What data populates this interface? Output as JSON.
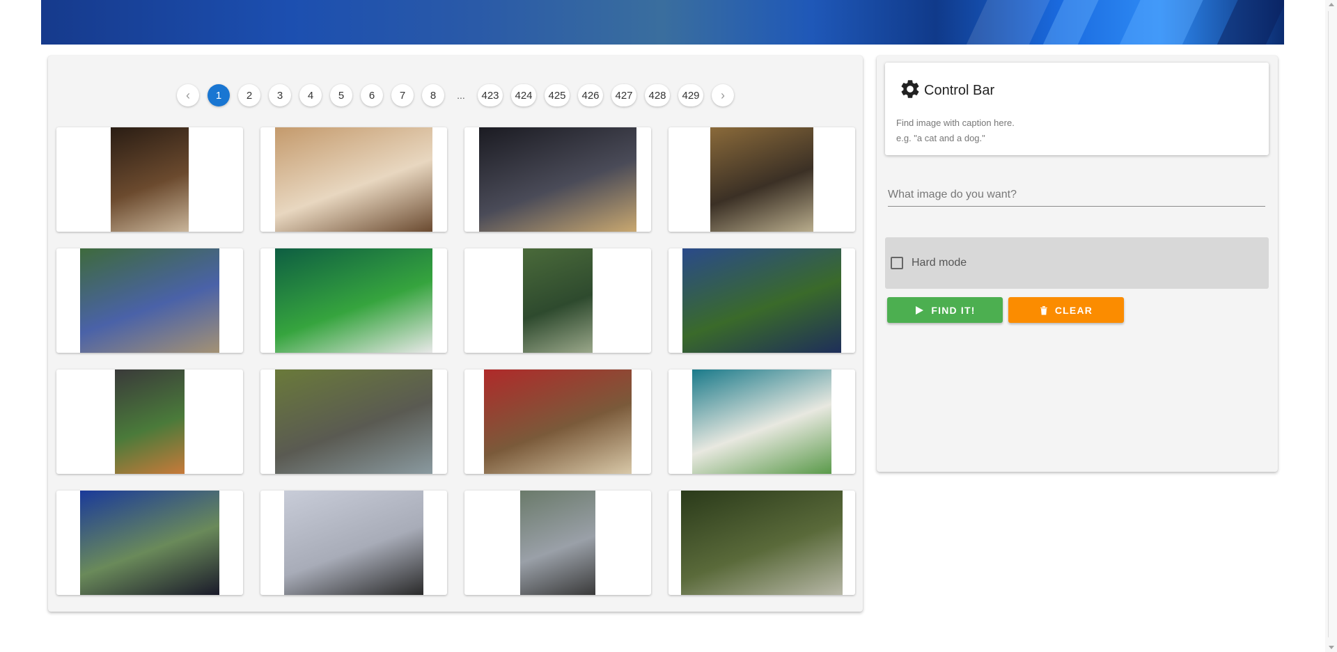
{
  "pager": {
    "prev": "‹",
    "next": "›",
    "pages_start": [
      "1",
      "2",
      "3",
      "4",
      "5",
      "6",
      "7",
      "8"
    ],
    "ellipsis": "...",
    "pages_end": [
      "423",
      "424",
      "425",
      "426",
      "427",
      "428",
      "429"
    ],
    "active": "1"
  },
  "control": {
    "title": "Control Bar",
    "hint_line1": "Find image with caption here.",
    "hint_line2": "e.g. \"a cat and a dog.\"",
    "search_placeholder": "What image do you want?",
    "search_value": "",
    "hard_mode_label": "Hard mode",
    "hard_mode_checked": false,
    "find_label": "FIND IT!",
    "clear_label": "CLEAR"
  },
  "images": [
    {
      "subject": "food platter on table",
      "palette": [
        "#2a1d14",
        "#6b4a2e",
        "#c9b59a"
      ]
    },
    {
      "subject": "living room with sofa",
      "palette": [
        "#c49a6c",
        "#e8d7c0",
        "#6a4a30"
      ]
    },
    {
      "subject": "two men shaking hands",
      "palette": [
        "#1b1b22",
        "#4a4b58",
        "#c9a870"
      ]
    },
    {
      "subject": "clock on wall",
      "palette": [
        "#8a6a3a",
        "#3b3025",
        "#b8ac8c"
      ]
    },
    {
      "subject": "tennis stadium",
      "palette": [
        "#3e6a3c",
        "#4a62a8",
        "#a49274"
      ]
    },
    {
      "subject": "tennis player in green",
      "palette": [
        "#0e5e42",
        "#36a43e",
        "#e8e8e8"
      ]
    },
    {
      "subject": "people at outdoor fair",
      "palette": [
        "#4a6a3a",
        "#2e4a2e",
        "#9aa78a"
      ]
    },
    {
      "subject": "cat on blue truck",
      "palette": [
        "#2a4a8a",
        "#3a6a2a",
        "#1e2e5a"
      ]
    },
    {
      "subject": "tennis player serving",
      "palette": [
        "#3a3a3a",
        "#4a7a3a",
        "#c87a3a"
      ]
    },
    {
      "subject": "elephants in grass",
      "palette": [
        "#6a7a3a",
        "#5a5a52",
        "#8a9aa0"
      ]
    },
    {
      "subject": "child with luggage",
      "palette": [
        "#b02a2a",
        "#7a5a3a",
        "#d8c8a8"
      ]
    },
    {
      "subject": "plates on blue table",
      "palette": [
        "#1a7a8a",
        "#e8e8e0",
        "#5a9a4a"
      ]
    },
    {
      "subject": "vases by window",
      "palette": [
        "#1a3a9a",
        "#6a8a5a",
        "#1a1a2a"
      ]
    },
    {
      "subject": "skiers on slope",
      "palette": [
        "#c8ccd8",
        "#a8acb8",
        "#2a2a2a"
      ]
    },
    {
      "subject": "skateboarder jumping",
      "palette": [
        "#6a7a6a",
        "#9aa0a8",
        "#3a3a3a"
      ]
    },
    {
      "subject": "cormorants on water",
      "palette": [
        "#2a3a1a",
        "#5a6a3a",
        "#b8b8a8"
      ]
    }
  ]
}
